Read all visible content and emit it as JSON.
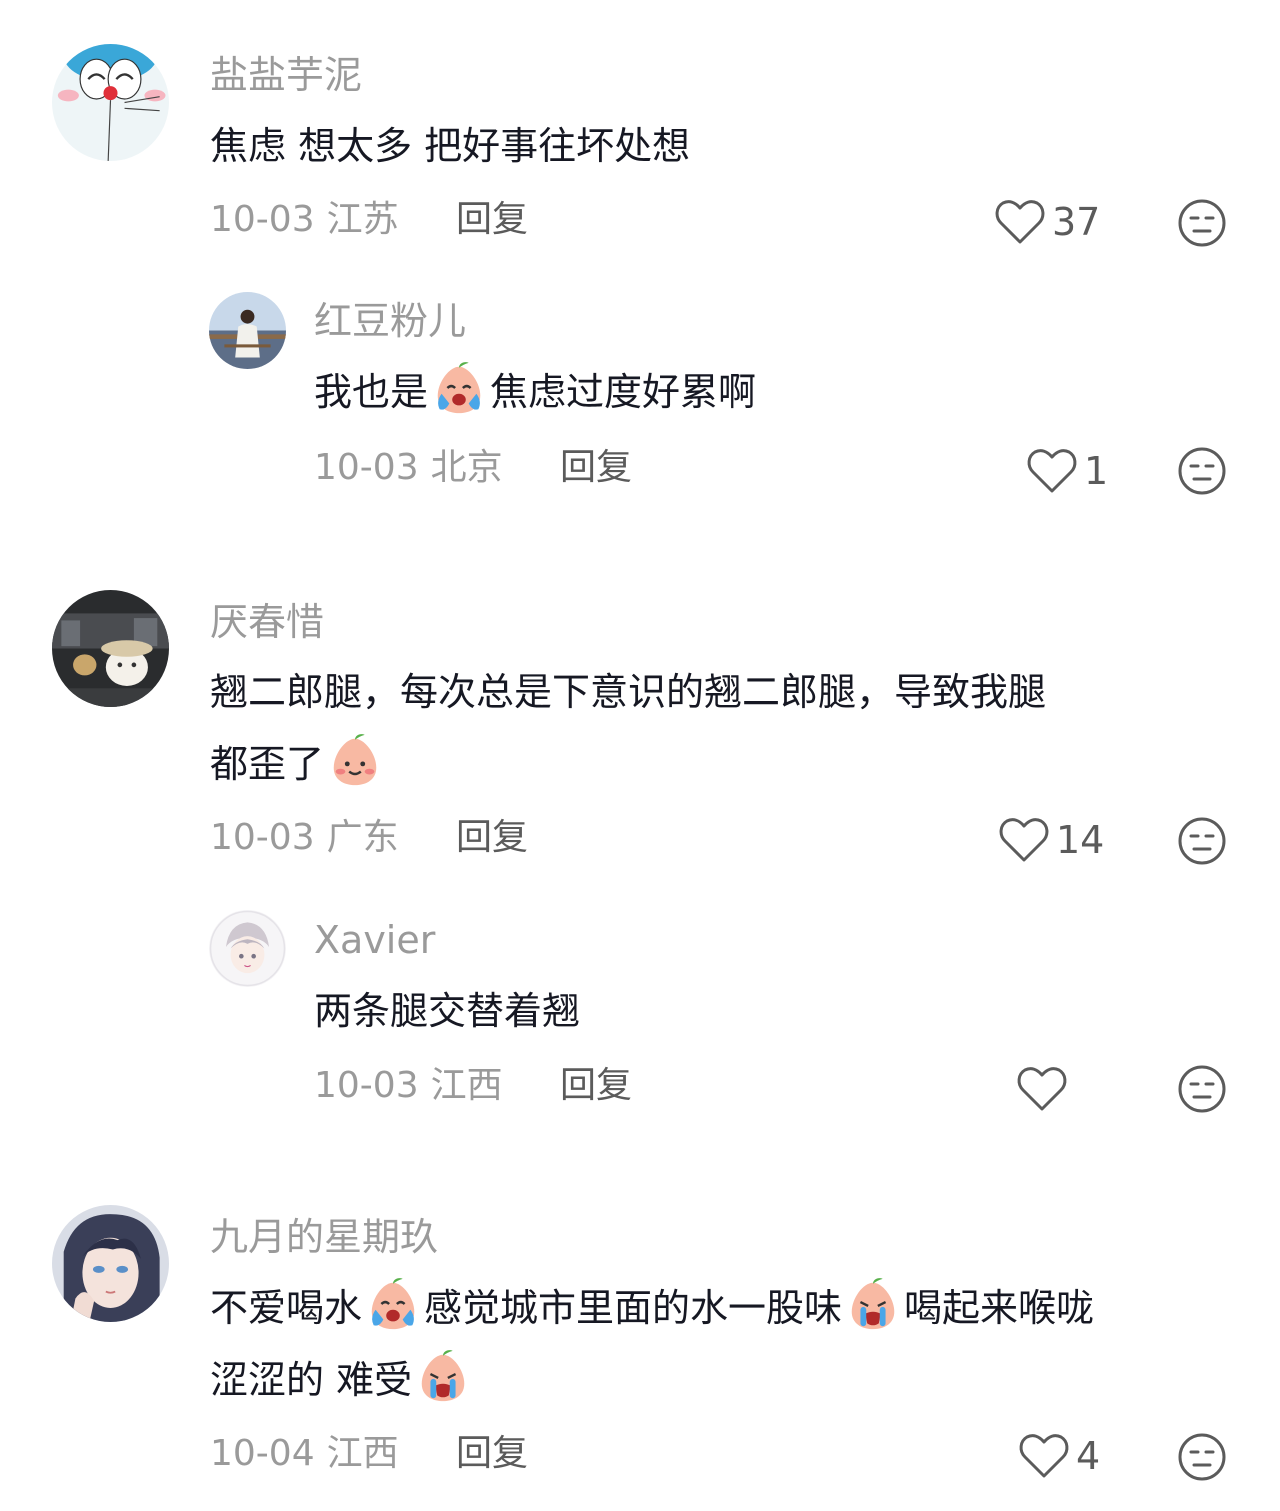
{
  "colors": {
    "username": "#9a9a9a",
    "text": "#161823",
    "meta": "#9a9a9a",
    "reply": "#5b5b5b",
    "icon": "#5b5b5b"
  },
  "comments": [
    {
      "username": "盐盐芋泥",
      "text_parts": [
        "焦虑 想太多 把好事往坏处想"
      ],
      "date": "10-03",
      "location": "江苏",
      "reply_label": "回复",
      "likes": "37",
      "avatar_icon": "doraemon-avatar"
    },
    {
      "username": "红豆粉儿",
      "text_parts": [
        "我也是",
        "焦虑过度好累啊"
      ],
      "emojis": [
        "crying-peach-emoji"
      ],
      "date": "10-03",
      "location": "北京",
      "reply_label": "回复",
      "likes": "1",
      "avatar_icon": "girl-photo-avatar"
    },
    {
      "username": "厌春惜",
      "text_parts": [
        "翘二郎腿，每次总是下意识的翘二郎腿，导致我腿",
        "都歪了"
      ],
      "emojis": [
        "smiling-peach-emoji"
      ],
      "date": "10-03",
      "location": "广东",
      "reply_label": "回复",
      "likes": "14",
      "avatar_icon": "anime-scene-avatar"
    },
    {
      "username": "Xavier",
      "text_parts": [
        "两条腿交替着翘"
      ],
      "date": "10-03",
      "location": "江西",
      "reply_label": "回复",
      "likes": "",
      "avatar_icon": "anime-boy-avatar"
    },
    {
      "username": "九月的星期玖",
      "text_parts": [
        "不爱喝水",
        "感觉城市里面的水一股味",
        "喝起来喉咙",
        "涩涩的 难受"
      ],
      "emojis": [
        "crying-peach-emoji",
        "sobbing-peach-emoji",
        "sobbing-peach-emoji"
      ],
      "date": "10-04",
      "location": "江西",
      "reply_label": "回复",
      "likes": "4",
      "avatar_icon": "anime-portrait-avatar"
    }
  ]
}
